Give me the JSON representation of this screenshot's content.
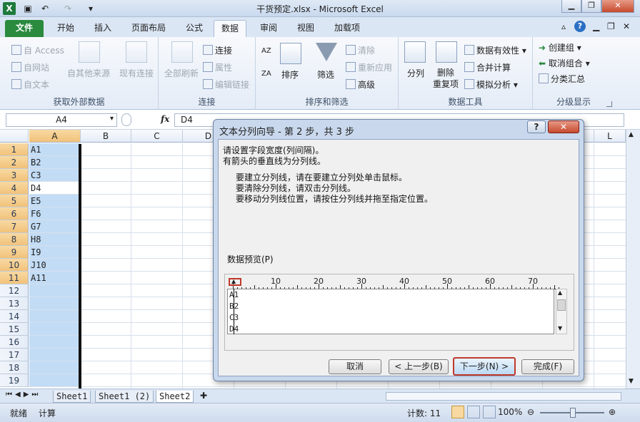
{
  "window": {
    "title": "干货预定.xlsx - Microsoft Excel"
  },
  "quick_access": [
    "excel-logo",
    "save",
    "undo",
    "redo",
    "customize"
  ],
  "ribbon_tabs": [
    "文件",
    "开始",
    "插入",
    "页面布局",
    "公式",
    "数据",
    "审阅",
    "视图",
    "加载项"
  ],
  "ribbon": {
    "get_external": {
      "access": "自 Access",
      "web": "自网站",
      "text": "自文本",
      "other": "自其他来源",
      "existing": "现有连接",
      "label": "获取外部数据"
    },
    "connections": {
      "refresh_all": "全部刷新",
      "connections": "连接",
      "properties": "属性",
      "edit_links": "编辑链接",
      "label": "连接"
    },
    "sort_filter": {
      "az": "AZ",
      "za": "ZA",
      "sort": "排序",
      "filter": "筛选",
      "clear": "清除",
      "reapply": "重新应用",
      "advanced": "高级",
      "label": "排序和筛选"
    },
    "data_tools": {
      "split": "分列",
      "remove_dup": "删除\n重复项",
      "validation": "数据有效性",
      "consolidate": "合并计算",
      "whatif": "模拟分析",
      "label": "数据工具"
    },
    "outline": {
      "group": "创建组",
      "ungroup": "取消组合",
      "subtotal": "分类汇总",
      "label": "分级显示"
    }
  },
  "formula_bar": {
    "name_box": "A4",
    "fx": "fx",
    "value": "D4"
  },
  "columns": [
    "A",
    "B",
    "C",
    "D",
    "E",
    "F",
    "G",
    "H",
    "I",
    "J",
    "K",
    "L"
  ],
  "rows": [
    "1",
    "2",
    "3",
    "4",
    "5",
    "6",
    "7",
    "8",
    "9",
    "10",
    "11",
    "12",
    "13",
    "14",
    "15",
    "16",
    "17",
    "18",
    "19"
  ],
  "cells_A": [
    "A1",
    "B2",
    "C3",
    "D4",
    "E5",
    "F6",
    "G7",
    "H8",
    "I9",
    "J10",
    "A11"
  ],
  "active_cell": "A4",
  "sheet_tabs": [
    "Sheet1",
    "Sheet1 (2)",
    "Sheet2"
  ],
  "active_sheet": "Sheet2",
  "status": {
    "ready": "就绪",
    "calc": "计算",
    "count": "计数: 11",
    "zoom": "100%"
  },
  "dialog": {
    "title": "文本分列向导 - 第 2 步，共 3 步",
    "help": "?",
    "close": "✕",
    "intro1": "请设置字段宽度(列间隔)。",
    "intro2": "有箭头的垂直线为分列线。",
    "tip1": "要建立分列线，请在要建立分列处单击鼠标。",
    "tip2": "要清除分列线，请双击分列线。",
    "tip3": "要移动分列线位置，请按住分列线并拖至指定位置。",
    "preview_label": "数据预览(P)",
    "ruler_labels": [
      "10",
      "20",
      "30",
      "40",
      "50",
      "60",
      "70"
    ],
    "preview_lines": [
      "A1",
      "B2",
      "C3",
      "D4"
    ],
    "btn_cancel": "取消",
    "btn_back": "< 上一步(B)",
    "btn_next": "下一步(N) >",
    "btn_finish": "完成(F)"
  },
  "colors": {
    "accent": "#2a8a3e",
    "highlight": "#c0392b",
    "selection": "#c3dcf5"
  }
}
